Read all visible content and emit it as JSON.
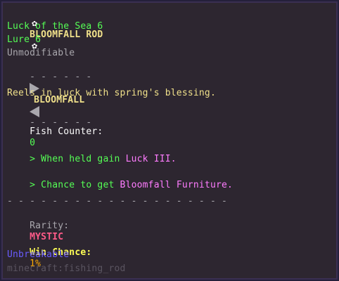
{
  "title": {
    "icon_left": "✿",
    "text": "BLOOMFALL ROD",
    "icon_right": "✿"
  },
  "enchants": [
    "Luck of the Sea 6",
    "Lure 6"
  ],
  "unmodifiable": "Unmodifiable",
  "divider": {
    "left": "- - - - - -",
    "label": "BLOOMFALL",
    "right": "- - - - - -"
  },
  "description": "Reels in luck with spring's blessing.",
  "fish_counter": {
    "label": "Fish Counter:",
    "value": "0"
  },
  "abilities": [
    {
      "prefix": "> When held gain ",
      "highlight": "Luck III."
    },
    {
      "prefix": "> Chance to get ",
      "highlight": "Bloomfall Furniture."
    }
  ],
  "separator": "- - - - - - - - - - - - - - - - - - - -",
  "rarity": {
    "label": "Rarity:",
    "value": "MYSTIC"
  },
  "win_chance": {
    "label": "Win Chance:",
    "value": "1%"
  },
  "unbreakable": "Unbreakable",
  "item_id": "minecraft:fishing_rod",
  "colors": {
    "title": "#f0e08a",
    "enchant": "#55ff55",
    "muted": "#a9a7ad",
    "description": "#f0e08a",
    "white": "#ffffff",
    "ability": "#55ff55",
    "highlight": "#ff7cff",
    "rarity": "#ff5a88",
    "win_label": "#ffff55",
    "win_value": "#ffaa00",
    "unbreakable": "#6a5cff",
    "item_id": "#5a5460"
  }
}
